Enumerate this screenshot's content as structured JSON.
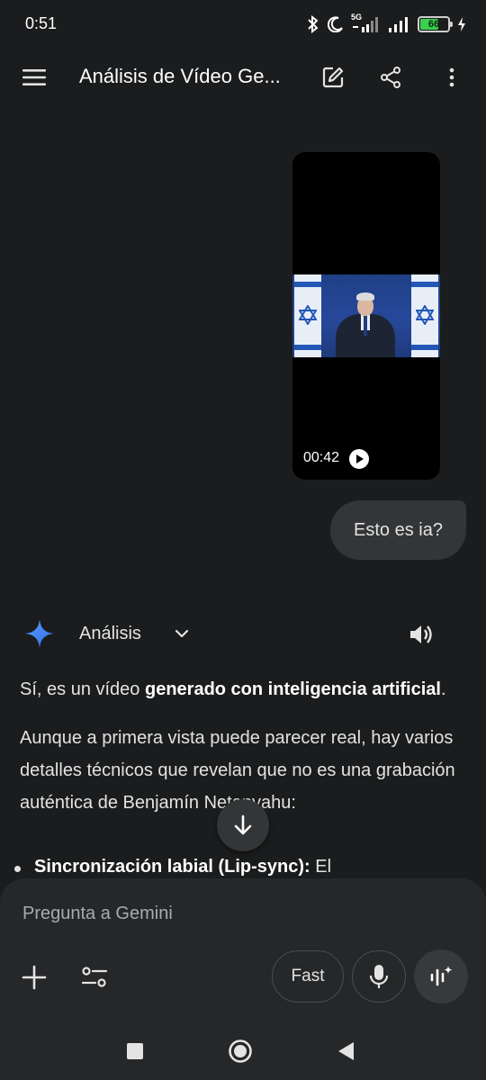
{
  "status_bar": {
    "time": "0:51",
    "network_label": "5G",
    "battery_level": "66",
    "battery_fraction": 0.66,
    "icons": [
      "bluetooth-icon",
      "moon-icon",
      "signal-icon",
      "signal-icon",
      "battery-icon",
      "charging-icon"
    ]
  },
  "app_bar": {
    "title": "Análisis de Vídeo Ge...",
    "icons": [
      "menu-icon",
      "edit-icon",
      "share-icon",
      "more-vert-icon"
    ]
  },
  "conversation": {
    "video_duration": "00:42",
    "user_message": "Esto es ia?",
    "response_mode": "Análisis",
    "response": {
      "p1_pre": "Sí, es un vídeo ",
      "p1_bold": "generado con inteligencia artificial",
      "p1_post": ".",
      "p2": "Aunque a primera vista puede parecer real, hay varios detalles técnicos que revelan que no es una grabación auténtica de Benjamín Netanyahu:",
      "bullet1_bold": "Sincronización labial (Lip-sync):",
      "bullet1_rest": " El"
    }
  },
  "composer": {
    "placeholder": "Pregunta a Gemini",
    "fast_label": "Fast"
  },
  "colors": {
    "background": "#1b1c1d",
    "bubble": "#333537",
    "composer": "#262729",
    "gemini_blue": "#4a8cf7",
    "battery_green": "#3ccf4e"
  }
}
